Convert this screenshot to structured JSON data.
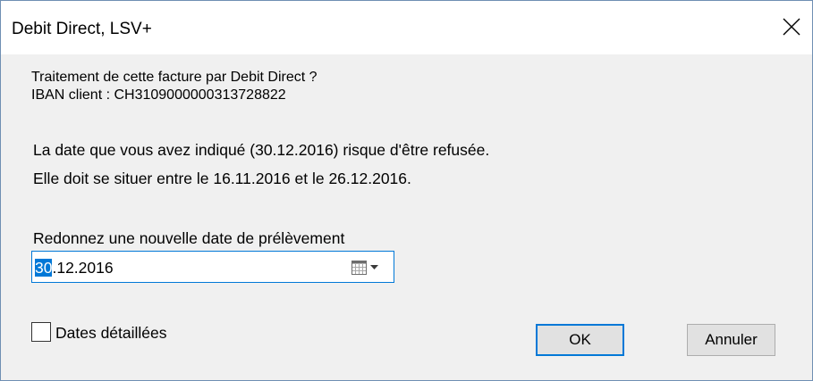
{
  "window": {
    "title": "Debit Direct, LSV+"
  },
  "intro": {
    "question": "Traitement de cette facture par Debit Direct  ?",
    "iban": "IBAN client : CH3109000000313728822"
  },
  "warning": {
    "line1": "La date que vous avez indiqué (30.12.2016) risque d'être refusée.",
    "line2": "Elle doit se situer entre le 16.11.2016 et le 26.12.2016."
  },
  "date_field": {
    "label": "Redonnez une nouvelle date de prélèvement",
    "value_selected": "30",
    "value_rest": ".12.2016",
    "calendar_icon": "calendar-dropdown-icon"
  },
  "options": {
    "detailed_dates_label": "Dates détaillées",
    "detailed_dates_checked": false
  },
  "buttons": {
    "ok": "OK",
    "cancel": "Annuler"
  },
  "colors": {
    "accent": "#0078d7",
    "dialog_bg": "#f0f0f0",
    "titlebar_bg": "#ffffff",
    "button_bg": "#e1e1e1"
  }
}
